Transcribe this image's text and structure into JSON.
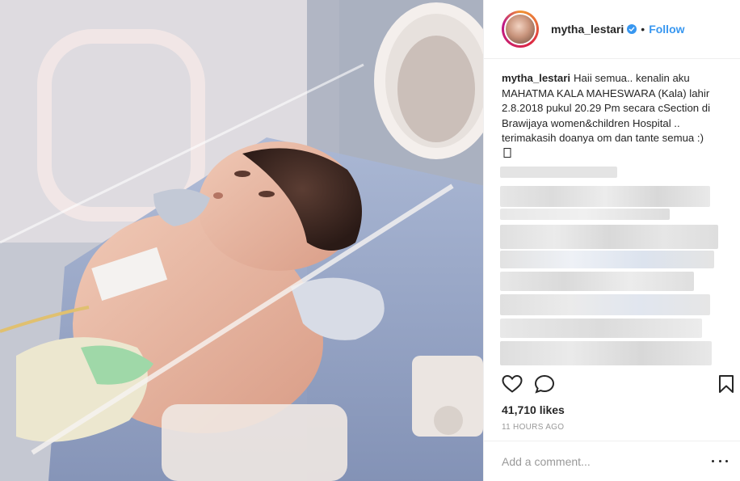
{
  "post": {
    "username": "mytha_lestari",
    "separator": "•",
    "follow_label": "Follow",
    "caption_text": "Haii semua.. kenalin aku MAHATMA KALA MAHESWARA (Kala) lahir 2.8.2018 pukul 20.29 Pm secara cSection di Brawijaya women&children Hospital .. terimakasih doanya om dan tante semua :)",
    "likes": "41,710 likes",
    "timestamp": "11 HOURS AGO",
    "comment_placeholder": "Add a comment..."
  },
  "icons": {
    "verified": "verified-badge-icon",
    "like": "heart-icon",
    "comment": "comment-icon",
    "save": "bookmark-icon",
    "more": "more-options-icon"
  },
  "colors": {
    "link_blue": "#3897f0",
    "text": "#262626",
    "muted": "#999999",
    "divider": "#efefef"
  }
}
